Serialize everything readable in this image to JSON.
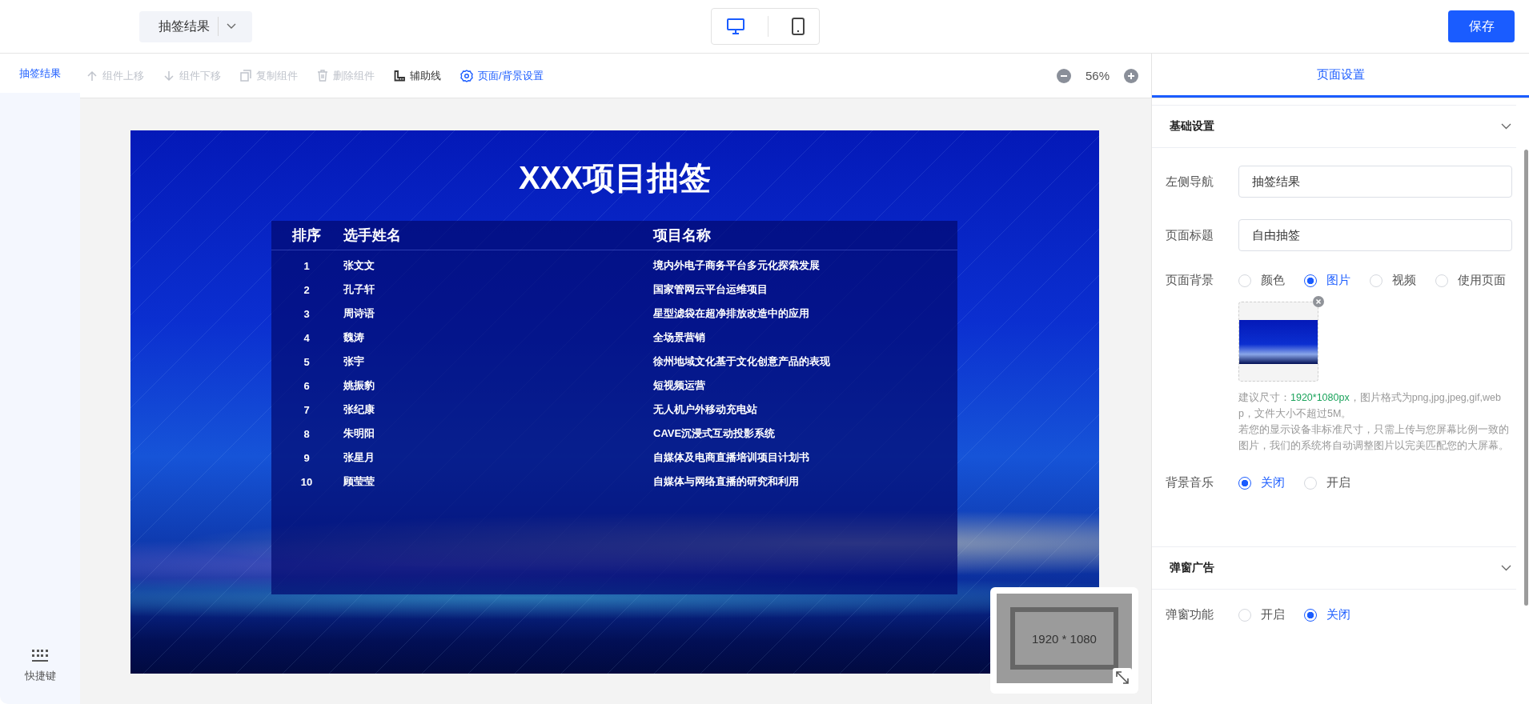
{
  "top_bar": {
    "page_select": {
      "value": "抽签结果"
    },
    "device_toggle": [
      {
        "kind": "desktop",
        "selected": true
      },
      {
        "kind": "mobile",
        "selected": false
      }
    ],
    "save_button": "保存"
  },
  "sidebar": {
    "items": [
      {
        "label": "抽签结果",
        "selected": true
      }
    ],
    "shortcut": "快捷键"
  },
  "toolbar": {
    "actions": [
      {
        "kind": "up",
        "label": "组件上移",
        "disabled": true
      },
      {
        "kind": "down",
        "label": "组件下移",
        "disabled": true
      },
      {
        "kind": "copy",
        "label": "复制组件",
        "disabled": true
      },
      {
        "kind": "delete",
        "label": "删除组件",
        "disabled": true
      },
      {
        "kind": "ruler",
        "label": "辅助线",
        "disabled": false
      },
      {
        "kind": "gear",
        "label": "页面/背景设置",
        "disabled": false
      }
    ],
    "zoom": "56%"
  },
  "canvas": {
    "title": "XXX项目抽签",
    "columns": [
      "排序",
      "选手姓名",
      "项目名称"
    ],
    "rows": [
      [
        "1",
        "张文文",
        "境内外电子商务平台多元化探索发展"
      ],
      [
        "2",
        "孔子轩",
        "国家管网云平台运维项目"
      ],
      [
        "3",
        "周诗语",
        "星型滤袋在超净排放改造中的应用"
      ],
      [
        "4",
        "魏涛",
        "全场景营销"
      ],
      [
        "5",
        "张宇",
        "徐州地域文化基于文化创意产品的表现"
      ],
      [
        "6",
        "姚振豹",
        "短视频运营"
      ],
      [
        "7",
        "张纪康",
        "无人机户外移动充电站"
      ],
      [
        "8",
        "朱明阳",
        "CAVE沉浸式互动投影系统"
      ],
      [
        "9",
        "张星月",
        "自媒体及电商直播培训项目计划书"
      ],
      [
        "10",
        "顾莹莹",
        "自媒体与网络直播的研究和利用"
      ]
    ]
  },
  "minimap": {
    "label": "1920 * 1080"
  },
  "settings_panel": {
    "tabs": [
      {
        "label": "页面设置",
        "selected": true
      }
    ],
    "sections": [
      {
        "title": "基础设置",
        "expanded": true,
        "fields": [
          {
            "kind": "input",
            "label": "左侧导航",
            "value": "抽签结果"
          },
          {
            "kind": "input",
            "label": "页面标题",
            "value": "自由抽签"
          },
          {
            "kind": "radio",
            "label": "页面背景",
            "options": [
              {
                "label": "颜色",
                "selected": false
              },
              {
                "label": "图片",
                "selected": true
              },
              {
                "label": "视频",
                "selected": false
              },
              {
                "label": "使用页面",
                "selected": false
              }
            ]
          },
          {
            "kind": "upload",
            "hint": [
              "建议尺寸：**1920*1080px**，图片格式为png,jpg,jpeg,gif,webp，文件大小不超过5M。",
              "若您的显示设备非标准尺寸，只需上传与您屏幕比例一致的图片，我们的系统将自动调整图片以完美匹配您的大屏幕。"
            ]
          },
          {
            "kind": "radio",
            "label": "背景音乐",
            "options": [
              {
                "label": "关闭",
                "selected": true
              },
              {
                "label": "开启",
                "selected": false
              }
            ]
          }
        ]
      },
      {
        "title": "弹窗广告",
        "expanded": true,
        "fields": [
          {
            "kind": "radio",
            "label": "弹窗功能",
            "options": [
              {
                "label": "开启",
                "selected": false
              },
              {
                "label": "关闭",
                "selected": true
              }
            ]
          }
        ]
      }
    ]
  }
}
